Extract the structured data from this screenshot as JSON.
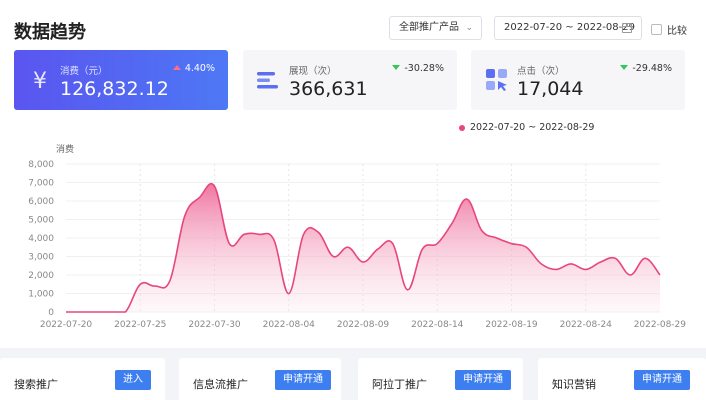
{
  "header": {
    "title": "数据趋势"
  },
  "filters": {
    "product_select": "全部推广产品",
    "date_range": "2022-07-20 ~ 2022-08-29",
    "compare_label": "比较"
  },
  "metrics": [
    {
      "label": "消费（元）",
      "value": "126,832.12",
      "change": "4.40%",
      "direction": "up",
      "icon": "yen-icon"
    },
    {
      "label": "展现（次）",
      "value": "366,631",
      "change": "-30.28%",
      "direction": "down",
      "icon": "bars-icon"
    },
    {
      "label": "点击（次）",
      "value": "17,044",
      "change": "-29.48%",
      "direction": "down",
      "icon": "click-grid-icon"
    }
  ],
  "colors": {
    "accent": "#4f6bf3",
    "series": "#e8467c",
    "up": "#ff6b8b",
    "down": "#34c759",
    "button": "#3d7ff0"
  },
  "chart_data": {
    "type": "area",
    "ylabel": "消费",
    "ylim": [
      0,
      8000
    ],
    "yticks": [
      "0",
      "1,000",
      "2,000",
      "3,000",
      "4,000",
      "5,000",
      "6,000",
      "7,000",
      "8,000"
    ],
    "xticks": [
      "2022-07-20",
      "2022-07-25",
      "2022-07-30",
      "2022-08-04",
      "2022-08-09",
      "2022-08-14",
      "2022-08-19",
      "2022-08-24",
      "2022-08-29"
    ],
    "series": [
      {
        "name": "2022-07-20 ~ 2022-08-29",
        "x": [
          "2022-07-20",
          "2022-07-21",
          "2022-07-22",
          "2022-07-23",
          "2022-07-24",
          "2022-07-25",
          "2022-07-26",
          "2022-07-27",
          "2022-07-28",
          "2022-07-29",
          "2022-07-30",
          "2022-07-31",
          "2022-08-01",
          "2022-08-02",
          "2022-08-03",
          "2022-08-04",
          "2022-08-05",
          "2022-08-06",
          "2022-08-07",
          "2022-08-08",
          "2022-08-09",
          "2022-08-10",
          "2022-08-11",
          "2022-08-12",
          "2022-08-13",
          "2022-08-14",
          "2022-08-15",
          "2022-08-16",
          "2022-08-17",
          "2022-08-18",
          "2022-08-19",
          "2022-08-20",
          "2022-08-21",
          "2022-08-22",
          "2022-08-23",
          "2022-08-24",
          "2022-08-25",
          "2022-08-26",
          "2022-08-27",
          "2022-08-28",
          "2022-08-29"
        ],
        "values": [
          0,
          0,
          0,
          0,
          0,
          1500,
          1400,
          1700,
          5200,
          6200,
          6800,
          3700,
          4200,
          4200,
          3900,
          1000,
          4200,
          4300,
          3000,
          3500,
          2700,
          3400,
          3700,
          1200,
          3400,
          3700,
          4800,
          6100,
          4400,
          4000,
          3700,
          3500,
          2600,
          2300,
          2600,
          2300,
          2700,
          2900,
          2000,
          2900,
          2000
        ]
      }
    ]
  },
  "products": [
    {
      "name": "搜索推广",
      "action": "进入"
    },
    {
      "name": "信息流推广",
      "action": "申请开通"
    },
    {
      "name": "阿拉丁推广",
      "action": "申请开通"
    },
    {
      "name": "知识营销",
      "action": "申请开通"
    }
  ]
}
